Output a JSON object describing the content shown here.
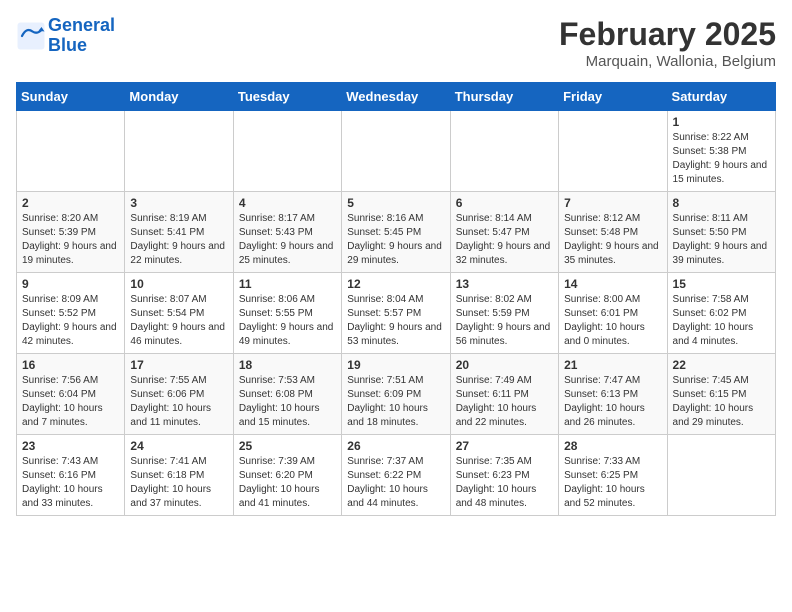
{
  "header": {
    "logo_line1": "General",
    "logo_line2": "Blue",
    "month_year": "February 2025",
    "location": "Marquain, Wallonia, Belgium"
  },
  "weekdays": [
    "Sunday",
    "Monday",
    "Tuesday",
    "Wednesday",
    "Thursday",
    "Friday",
    "Saturday"
  ],
  "weeks": [
    [
      {
        "day": "",
        "info": ""
      },
      {
        "day": "",
        "info": ""
      },
      {
        "day": "",
        "info": ""
      },
      {
        "day": "",
        "info": ""
      },
      {
        "day": "",
        "info": ""
      },
      {
        "day": "",
        "info": ""
      },
      {
        "day": "1",
        "info": "Sunrise: 8:22 AM\nSunset: 5:38 PM\nDaylight: 9 hours and 15 minutes."
      }
    ],
    [
      {
        "day": "2",
        "info": "Sunrise: 8:20 AM\nSunset: 5:39 PM\nDaylight: 9 hours and 19 minutes."
      },
      {
        "day": "3",
        "info": "Sunrise: 8:19 AM\nSunset: 5:41 PM\nDaylight: 9 hours and 22 minutes."
      },
      {
        "day": "4",
        "info": "Sunrise: 8:17 AM\nSunset: 5:43 PM\nDaylight: 9 hours and 25 minutes."
      },
      {
        "day": "5",
        "info": "Sunrise: 8:16 AM\nSunset: 5:45 PM\nDaylight: 9 hours and 29 minutes."
      },
      {
        "day": "6",
        "info": "Sunrise: 8:14 AM\nSunset: 5:47 PM\nDaylight: 9 hours and 32 minutes."
      },
      {
        "day": "7",
        "info": "Sunrise: 8:12 AM\nSunset: 5:48 PM\nDaylight: 9 hours and 35 minutes."
      },
      {
        "day": "8",
        "info": "Sunrise: 8:11 AM\nSunset: 5:50 PM\nDaylight: 9 hours and 39 minutes."
      }
    ],
    [
      {
        "day": "9",
        "info": "Sunrise: 8:09 AM\nSunset: 5:52 PM\nDaylight: 9 hours and 42 minutes."
      },
      {
        "day": "10",
        "info": "Sunrise: 8:07 AM\nSunset: 5:54 PM\nDaylight: 9 hours and 46 minutes."
      },
      {
        "day": "11",
        "info": "Sunrise: 8:06 AM\nSunset: 5:55 PM\nDaylight: 9 hours and 49 minutes."
      },
      {
        "day": "12",
        "info": "Sunrise: 8:04 AM\nSunset: 5:57 PM\nDaylight: 9 hours and 53 minutes."
      },
      {
        "day": "13",
        "info": "Sunrise: 8:02 AM\nSunset: 5:59 PM\nDaylight: 9 hours and 56 minutes."
      },
      {
        "day": "14",
        "info": "Sunrise: 8:00 AM\nSunset: 6:01 PM\nDaylight: 10 hours and 0 minutes."
      },
      {
        "day": "15",
        "info": "Sunrise: 7:58 AM\nSunset: 6:02 PM\nDaylight: 10 hours and 4 minutes."
      }
    ],
    [
      {
        "day": "16",
        "info": "Sunrise: 7:56 AM\nSunset: 6:04 PM\nDaylight: 10 hours and 7 minutes."
      },
      {
        "day": "17",
        "info": "Sunrise: 7:55 AM\nSunset: 6:06 PM\nDaylight: 10 hours and 11 minutes."
      },
      {
        "day": "18",
        "info": "Sunrise: 7:53 AM\nSunset: 6:08 PM\nDaylight: 10 hours and 15 minutes."
      },
      {
        "day": "19",
        "info": "Sunrise: 7:51 AM\nSunset: 6:09 PM\nDaylight: 10 hours and 18 minutes."
      },
      {
        "day": "20",
        "info": "Sunrise: 7:49 AM\nSunset: 6:11 PM\nDaylight: 10 hours and 22 minutes."
      },
      {
        "day": "21",
        "info": "Sunrise: 7:47 AM\nSunset: 6:13 PM\nDaylight: 10 hours and 26 minutes."
      },
      {
        "day": "22",
        "info": "Sunrise: 7:45 AM\nSunset: 6:15 PM\nDaylight: 10 hours and 29 minutes."
      }
    ],
    [
      {
        "day": "23",
        "info": "Sunrise: 7:43 AM\nSunset: 6:16 PM\nDaylight: 10 hours and 33 minutes."
      },
      {
        "day": "24",
        "info": "Sunrise: 7:41 AM\nSunset: 6:18 PM\nDaylight: 10 hours and 37 minutes."
      },
      {
        "day": "25",
        "info": "Sunrise: 7:39 AM\nSunset: 6:20 PM\nDaylight: 10 hours and 41 minutes."
      },
      {
        "day": "26",
        "info": "Sunrise: 7:37 AM\nSunset: 6:22 PM\nDaylight: 10 hours and 44 minutes."
      },
      {
        "day": "27",
        "info": "Sunrise: 7:35 AM\nSunset: 6:23 PM\nDaylight: 10 hours and 48 minutes."
      },
      {
        "day": "28",
        "info": "Sunrise: 7:33 AM\nSunset: 6:25 PM\nDaylight: 10 hours and 52 minutes."
      },
      {
        "day": "",
        "info": ""
      }
    ]
  ]
}
